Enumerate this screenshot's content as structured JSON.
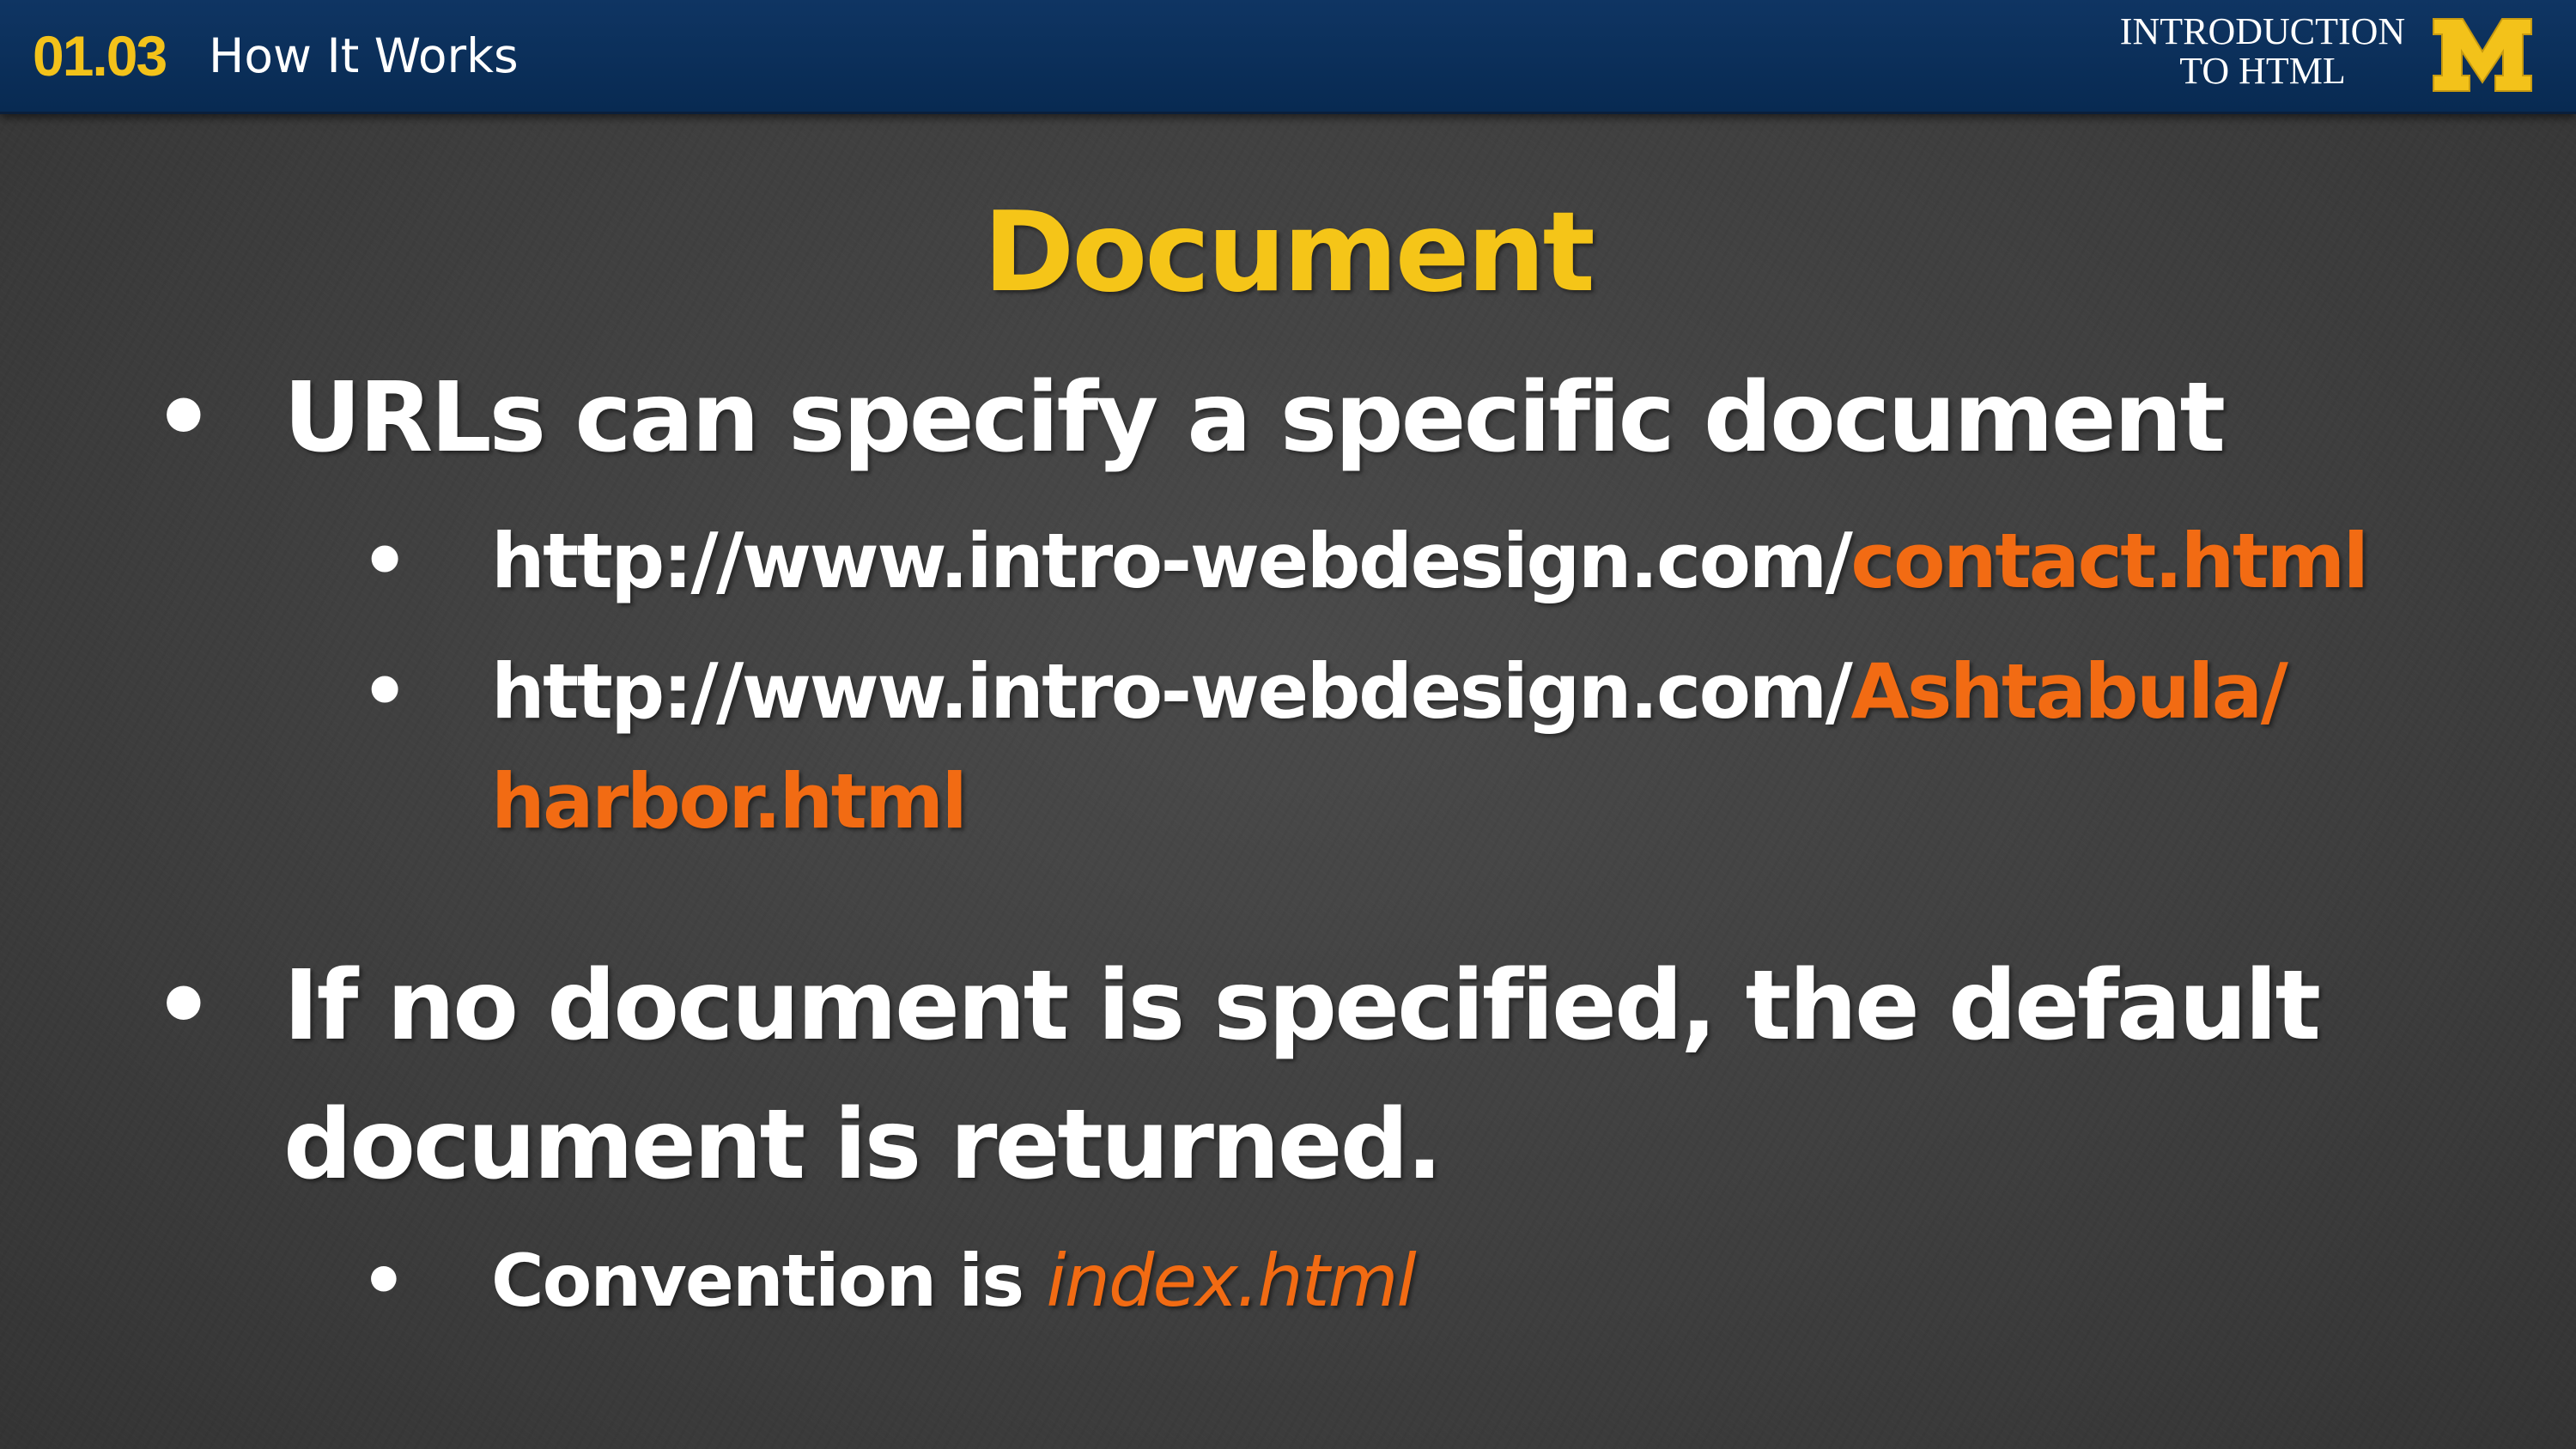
{
  "header": {
    "lesson_number": "01.03",
    "lesson_title": "How It Works",
    "course_title_line1": "INTRODUCTION",
    "course_title_line2": "TO HTML",
    "logo_icon": "block-m-logo",
    "logo_letter": "M"
  },
  "slide": {
    "title": "Document",
    "bullets": [
      {
        "text": "URLs can specify a specific document",
        "sub": [
          {
            "prefix": "http://www.intro-webdesign.com/",
            "highlight": "contact.html"
          },
          {
            "prefix": "http://www.intro-webdesign.com/",
            "highlight": "Ashtabula/",
            "highlight_line2": "harbor.html"
          }
        ]
      },
      {
        "text_line1": "If no document is specified, the default",
        "text_line2": "document is returned.",
        "sub": [
          {
            "prefix": "Convention is ",
            "highlight": "index.html"
          }
        ]
      }
    ],
    "bullet_glyph": "•"
  },
  "colors": {
    "header_bg": "#0b2d57",
    "accent_yellow": "#f5c518",
    "highlight_orange": "#f26b13",
    "background": "#3f3f3f",
    "text": "#ffffff"
  }
}
